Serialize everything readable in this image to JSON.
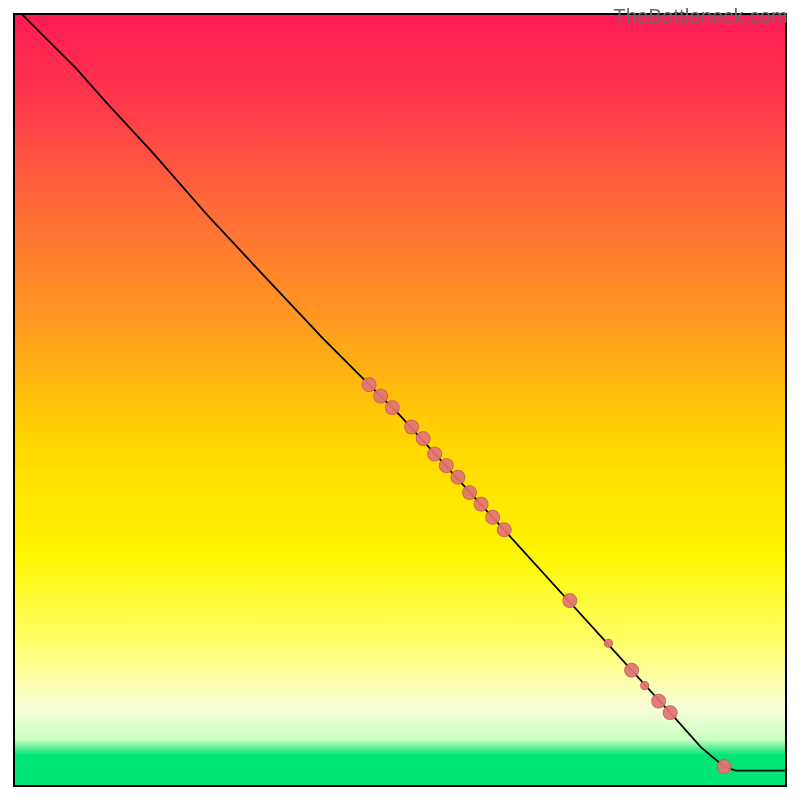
{
  "watermark": "TheBottleneck.com",
  "chart_data": {
    "type": "line",
    "title": "",
    "xlabel": "",
    "ylabel": "",
    "xlim": [
      0,
      100
    ],
    "ylim": [
      0,
      100
    ],
    "background_gradient_css": "linear-gradient(to bottom, #ff1a55 0%, #ff5a3c 22%, #ffb000 50%, #fff600 72%, #ffff9a 86%, #f6ffe0 92%, #00e676 96%, #00e676 100%)",
    "curve": {
      "name": "bottleneck-curve",
      "color": "#000000",
      "width": 1.8,
      "points": [
        {
          "x": 1.0,
          "y": 100.0
        },
        {
          "x": 4.0,
          "y": 97.0
        },
        {
          "x": 8.0,
          "y": 93.0
        },
        {
          "x": 12.0,
          "y": 88.5
        },
        {
          "x": 18.0,
          "y": 82.0
        },
        {
          "x": 25.0,
          "y": 74.0
        },
        {
          "x": 32.0,
          "y": 66.5
        },
        {
          "x": 40.0,
          "y": 58.0
        },
        {
          "x": 46.0,
          "y": 52.0
        },
        {
          "x": 50.0,
          "y": 48.0
        },
        {
          "x": 55.0,
          "y": 42.5
        },
        {
          "x": 60.0,
          "y": 37.0
        },
        {
          "x": 65.0,
          "y": 31.5
        },
        {
          "x": 70.0,
          "y": 26.0
        },
        {
          "x": 75.0,
          "y": 20.5
        },
        {
          "x": 80.0,
          "y": 15.0
        },
        {
          "x": 85.0,
          "y": 9.5
        },
        {
          "x": 89.0,
          "y": 5.0
        },
        {
          "x": 92.0,
          "y": 2.5
        },
        {
          "x": 93.5,
          "y": 2.0
        },
        {
          "x": 100.0,
          "y": 2.0
        }
      ]
    },
    "markers": {
      "color": "#e57373",
      "stroke": "#b65a5a",
      "radii": {
        "small": 4.2,
        "large": 7.0
      },
      "points": [
        {
          "x": 46.0,
          "y": 52.0,
          "r": "large"
        },
        {
          "x": 47.5,
          "y": 50.5,
          "r": "large"
        },
        {
          "x": 49.0,
          "y": 49.0,
          "r": "large"
        },
        {
          "x": 51.5,
          "y": 46.5,
          "r": "large"
        },
        {
          "x": 53.0,
          "y": 45.0,
          "r": "large"
        },
        {
          "x": 54.5,
          "y": 43.0,
          "r": "large"
        },
        {
          "x": 56.0,
          "y": 41.5,
          "r": "large"
        },
        {
          "x": 57.5,
          "y": 40.0,
          "r": "large"
        },
        {
          "x": 59.0,
          "y": 38.0,
          "r": "large"
        },
        {
          "x": 60.5,
          "y": 36.5,
          "r": "large"
        },
        {
          "x": 62.0,
          "y": 34.8,
          "r": "large"
        },
        {
          "x": 63.5,
          "y": 33.2,
          "r": "large"
        },
        {
          "x": 72.0,
          "y": 24.0,
          "r": "large"
        },
        {
          "x": 77.0,
          "y": 18.5,
          "r": "small"
        },
        {
          "x": 80.0,
          "y": 15.0,
          "r": "large"
        },
        {
          "x": 81.7,
          "y": 13.0,
          "r": "small"
        },
        {
          "x": 83.5,
          "y": 11.0,
          "r": "large"
        },
        {
          "x": 85.0,
          "y": 9.5,
          "r": "large"
        },
        {
          "x": 92.0,
          "y": 2.5,
          "r": "large"
        }
      ]
    }
  }
}
